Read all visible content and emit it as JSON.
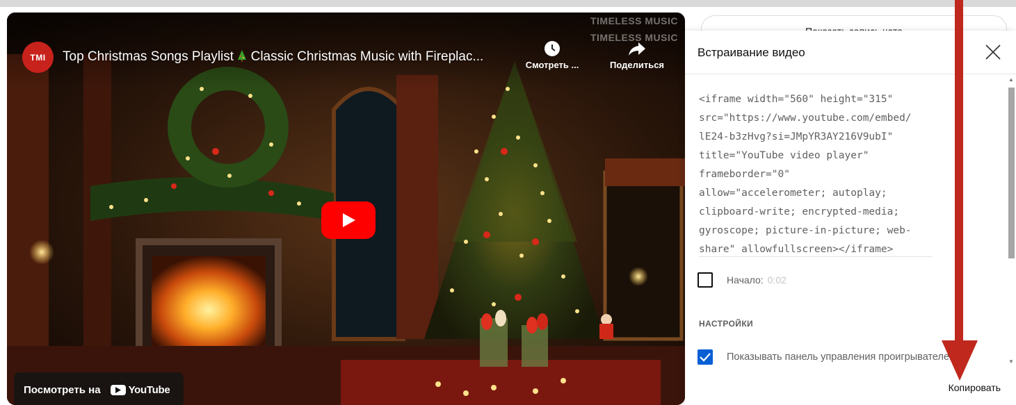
{
  "background": {
    "chat_button_label": "Показать запись чата"
  },
  "player": {
    "channel_avatar_text": "TMI",
    "title": "Top Christmas Songs Playlist",
    "title_tail": "Classic Christmas Music with Fireplac...",
    "watermark": "TIMELESS MUSIC",
    "watch_later_label": "Смотреть ...",
    "share_label": "Поделиться",
    "watch_on_label": "Посмотреть на",
    "youtube_label": "YouTube"
  },
  "dialog": {
    "title": "Встраивание видео",
    "code_lines": [
      "<iframe width=\"560\" height=\"315\"",
      "src=\"https://www.youtube.com/embed/",
      "lE24-b3zHvg?si=JMpYR3AY216V9ubI\"",
      "title=\"YouTube video player\"",
      "frameborder=\"0\"",
      "allow=\"accelerometer; autoplay;",
      "clipboard-write; encrypted-media;",
      "gyroscope; picture-in-picture; web-",
      "share\" allowfullscreen></iframe>"
    ],
    "start_label": "Начало:",
    "start_time": "0:02",
    "start_checked": false,
    "settings_header": "НАСТРОЙКИ",
    "controls_label": "Показывать панель управления проигрывателем",
    "controls_checked": true,
    "copy_label": "Копировать"
  },
  "colors": {
    "play_button": "#ff0000",
    "checkbox_accent": "#065fd4",
    "avatar": "#c8221c",
    "annotation_arrow": "#c0281d"
  }
}
